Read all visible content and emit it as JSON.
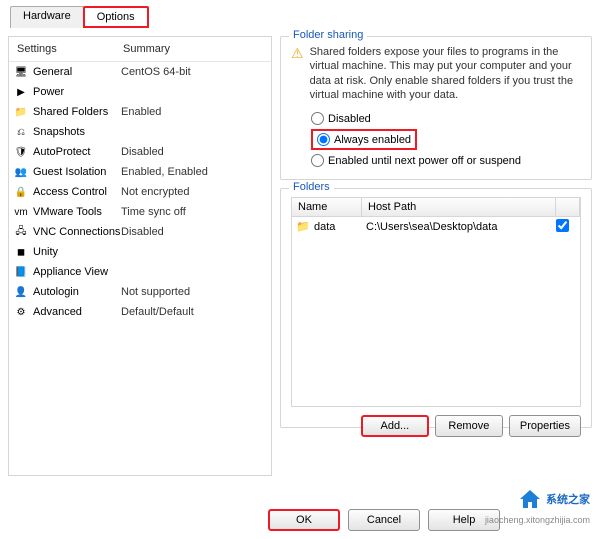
{
  "tabs": {
    "hardware": "Hardware",
    "options": "Options"
  },
  "settings": {
    "header_settings": "Settings",
    "header_summary": "Summary",
    "rows": [
      {
        "icon": "🖥",
        "label": "General",
        "summary": "CentOS 64-bit"
      },
      {
        "icon": "▶",
        "label": "Power",
        "summary": ""
      },
      {
        "icon": "📁",
        "label": "Shared Folders",
        "summary": "Enabled"
      },
      {
        "icon": "⎌",
        "label": "Snapshots",
        "summary": ""
      },
      {
        "icon": "🛡",
        "label": "AutoProtect",
        "summary": "Disabled"
      },
      {
        "icon": "👥",
        "label": "Guest Isolation",
        "summary": "Enabled, Enabled"
      },
      {
        "icon": "🔒",
        "label": "Access Control",
        "summary": "Not encrypted"
      },
      {
        "icon": "vm",
        "label": "VMware Tools",
        "summary": "Time sync off"
      },
      {
        "icon": "🖧",
        "label": "VNC Connections",
        "summary": "Disabled"
      },
      {
        "icon": "◼",
        "label": "Unity",
        "summary": ""
      },
      {
        "icon": "📘",
        "label": "Appliance View",
        "summary": ""
      },
      {
        "icon": "👤",
        "label": "Autologin",
        "summary": "Not supported"
      },
      {
        "icon": "⚙",
        "label": "Advanced",
        "summary": "Default/Default"
      }
    ]
  },
  "folder_sharing": {
    "title": "Folder sharing",
    "warning": "Shared folders expose your files to programs in the virtual machine. This may put your computer and your data at risk. Only enable shared folders if you trust the virtual machine with your data.",
    "opt_disabled": "Disabled",
    "opt_always": "Always enabled",
    "opt_until": "Enabled until next power off or suspend"
  },
  "folders": {
    "title": "Folders",
    "hdr_name": "Name",
    "hdr_host": "Host Path",
    "rows": [
      {
        "name": "data",
        "host": "C:\\Users\\sea\\Desktop\\data",
        "checked": true
      }
    ]
  },
  "buttons": {
    "add": "Add...",
    "remove": "Remove",
    "properties": "Properties",
    "ok": "OK",
    "cancel": "Cancel",
    "help": "Help"
  },
  "watermark": {
    "title": "系统之家",
    "sub": "jiaocheng.xitongzhijia.com"
  }
}
